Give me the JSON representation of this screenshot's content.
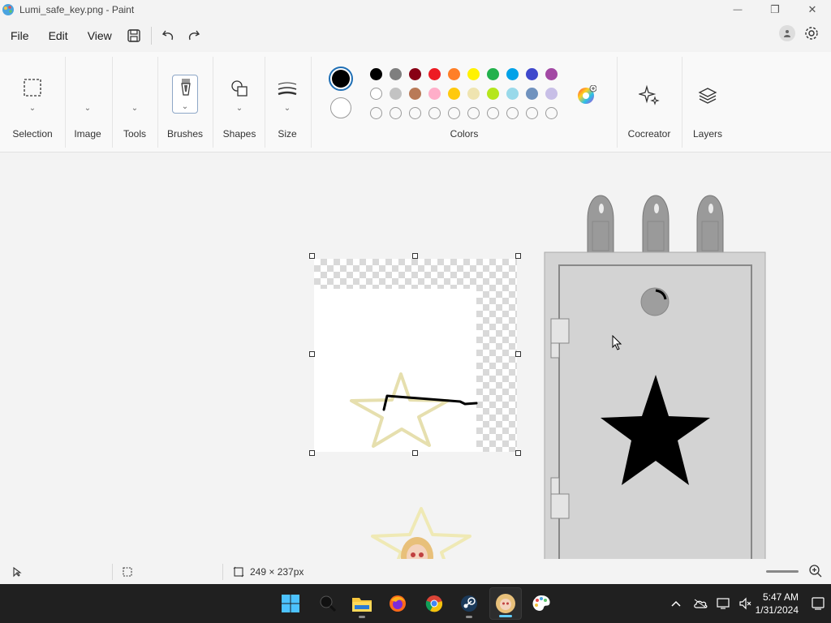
{
  "window": {
    "title": "Lumi_safe_key.png - Paint",
    "minimize_symbol": "—",
    "maximize_symbol": "❐",
    "close_symbol": "✕"
  },
  "menu": {
    "items": [
      "File",
      "Edit",
      "View"
    ]
  },
  "ribbon": {
    "groups": {
      "selection": "Selection",
      "image": "Image",
      "tools": "Tools",
      "brushes": "Brushes",
      "shapes": "Shapes",
      "size": "Size",
      "colors": "Colors",
      "cocreator": "Cocreator",
      "layers": "Layers"
    },
    "palette_row1": [
      "#000000",
      "#7f7f7f",
      "#880015",
      "#ed1c24",
      "#ff7f27",
      "#fff200",
      "#22b14c",
      "#00a2e8",
      "#3f48cc",
      "#a349a4"
    ],
    "palette_row2": [
      "#ffffff",
      "#c3c3c3",
      "#b97a57",
      "#ffaec9",
      "#ffc90e",
      "#efe4b0",
      "#b5e61d",
      "#99d9ea",
      "#7092be",
      "#c8bfe7"
    ],
    "primary_color": "#000000",
    "secondary_color": "#ffffff"
  },
  "status": {
    "image_size": "249 × 237px"
  },
  "taskbar": {
    "apps": [
      "start",
      "search",
      "file-explorer",
      "firefox",
      "chrome",
      "steam",
      "lumi-app",
      "paint"
    ],
    "time": "5:47 AM",
    "date": "1/31/2024"
  }
}
